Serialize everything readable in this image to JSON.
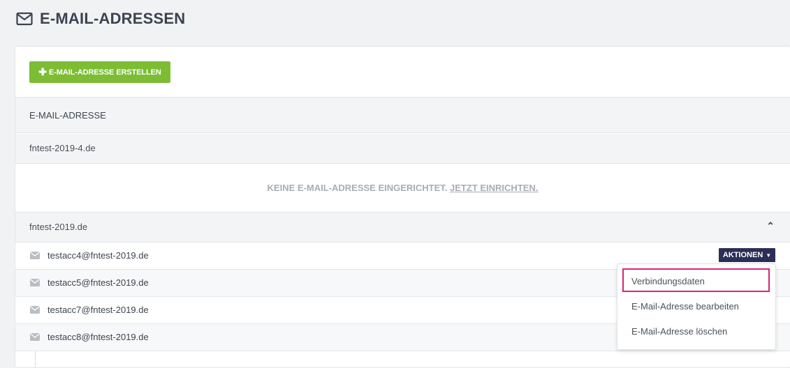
{
  "header": {
    "title": "E-MAIL-ADRESSEN",
    "icon": "envelope-icon"
  },
  "toolbar": {
    "create_label": "E-MAIL-ADRESSE ERSTELLEN",
    "plus_glyph": "✚"
  },
  "table": {
    "column_header": "E-MAIL-ADRESSE"
  },
  "domains": [
    {
      "name": "fntest-2019-4.de",
      "empty_text": "KEINE E-MAIL-ADRESSE EINGERICHTET.",
      "empty_link": "JETZT EINRICHTEN."
    },
    {
      "name": "fntest-2019.de",
      "expanded": true,
      "accounts": [
        "testacc4@fntest-2019.de",
        "testacc5@fntest-2019.de",
        "testacc7@fntest-2019.de",
        "testacc8@fntest-2019.de"
      ]
    }
  ],
  "actions": {
    "label": "AKTIONEN",
    "menu": [
      "Verbindungsdaten",
      "E-Mail-Adresse bearbeiten",
      "E-Mail-Adresse löschen"
    ],
    "highlighted": "Verbindungsdaten"
  },
  "colors": {
    "accent_green": "#7cbd34",
    "actions_navy": "#2b2e55",
    "highlight_pink": "#d1287a"
  }
}
